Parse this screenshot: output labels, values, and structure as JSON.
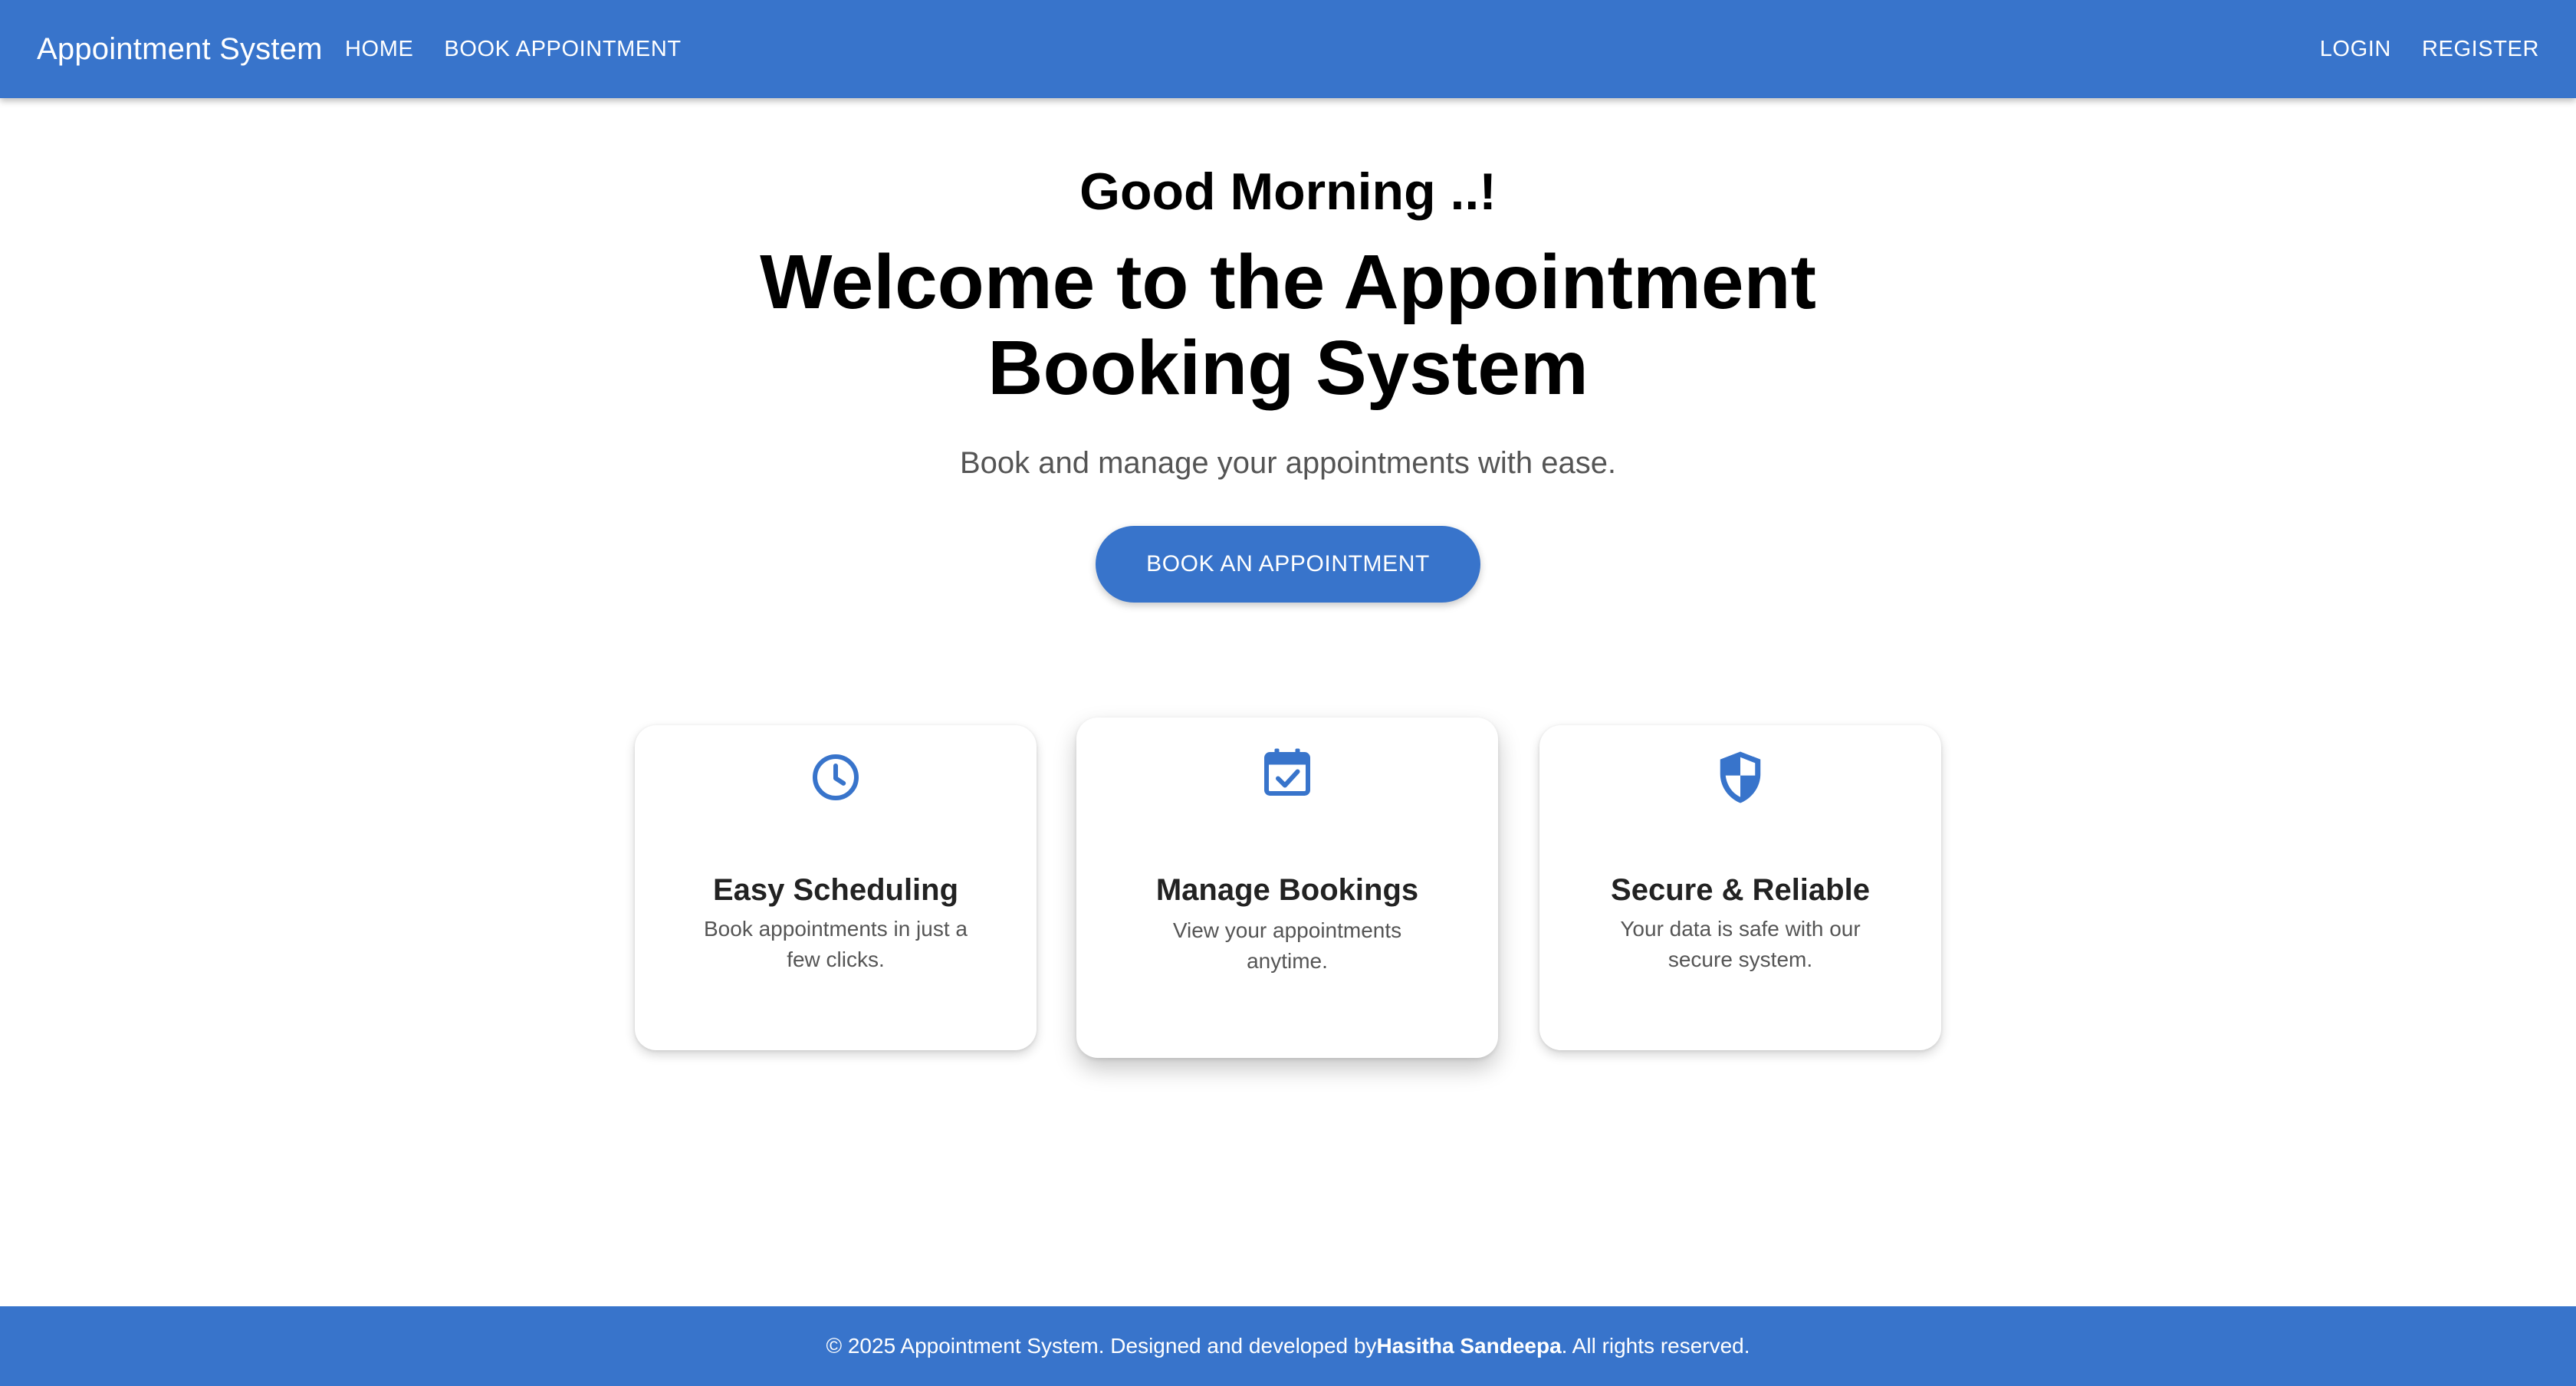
{
  "colors": {
    "primary": "#3874cb",
    "text": "#000000",
    "muted_text": "#555555",
    "card_background": "#ffffff"
  },
  "appbar": {
    "brand": "Appointment System",
    "nav_left": [
      {
        "label": "HOME"
      },
      {
        "label": "BOOK APPOINTMENT"
      }
    ],
    "nav_right": [
      {
        "label": "LOGIN"
      },
      {
        "label": "REGISTER"
      }
    ]
  },
  "hero": {
    "greeting": "Good Morning ..!",
    "headline": "Welcome to the Appointment Booking System",
    "subtitle": "Book and manage your appointments with ease.",
    "cta_label": "BOOK AN APPOINTMENT"
  },
  "features": [
    {
      "icon": "clock-icon",
      "title": "Easy Scheduling",
      "description": "Book appointments in just a few clicks."
    },
    {
      "icon": "calendar-check-icon",
      "title": "Manage Bookings",
      "description": "View your appointments anytime."
    },
    {
      "icon": "shield-icon",
      "title": "Secure & Reliable",
      "description": "Your data is safe with our secure system."
    }
  ],
  "footer": {
    "prefix": "© 2025 Appointment System. Designed and developed by ",
    "author": "Hasitha Sandeepa",
    "suffix": ". All rights reserved."
  }
}
